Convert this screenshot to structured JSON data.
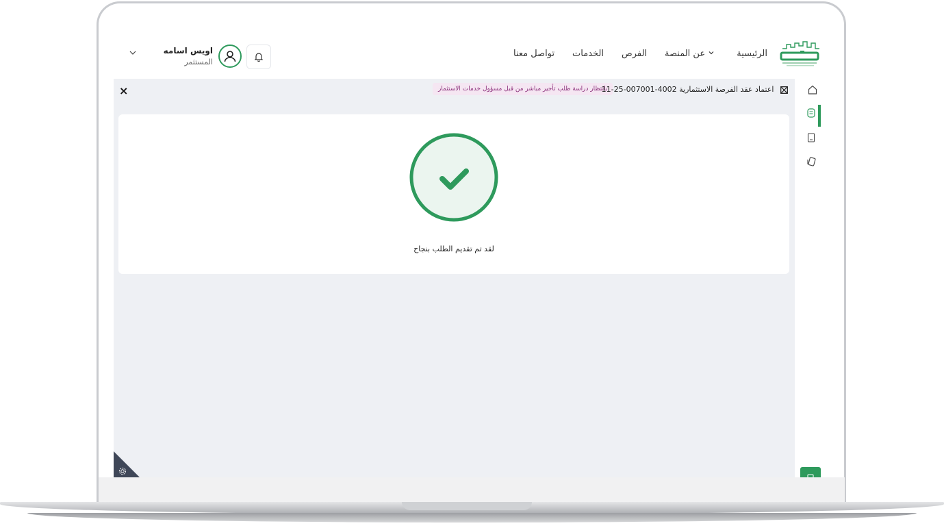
{
  "header": {
    "nav": [
      "الرئيسية",
      "عن المنصة",
      "الفرص",
      "الخدمات",
      "تواصل معنا"
    ],
    "user": {
      "name": "اويس اسامه",
      "role": "المستثمر"
    }
  },
  "content": {
    "title": "اعتماد عقد الفرصة الاستثمارية 4002-007001-25-11",
    "status_badge": "بانتظار دراسة طلب تأجير مباشر من قبل مسؤول خدمات الاستثمار",
    "close_label": "×",
    "success_message": "لقد تم تقديم الطلب بنجاح"
  },
  "colors": {
    "accent": "#2e9a5c",
    "content_bg": "#eef0f4",
    "badge_bg": "#f5e6f2",
    "badge_text": "#8a2f7a"
  },
  "icons": [
    "home-icon",
    "document-icon",
    "receipt-icon",
    "cards-icon",
    "bell-icon",
    "user-avatar-icon",
    "chevron-down-icon",
    "check-icon",
    "gear-icon"
  ]
}
